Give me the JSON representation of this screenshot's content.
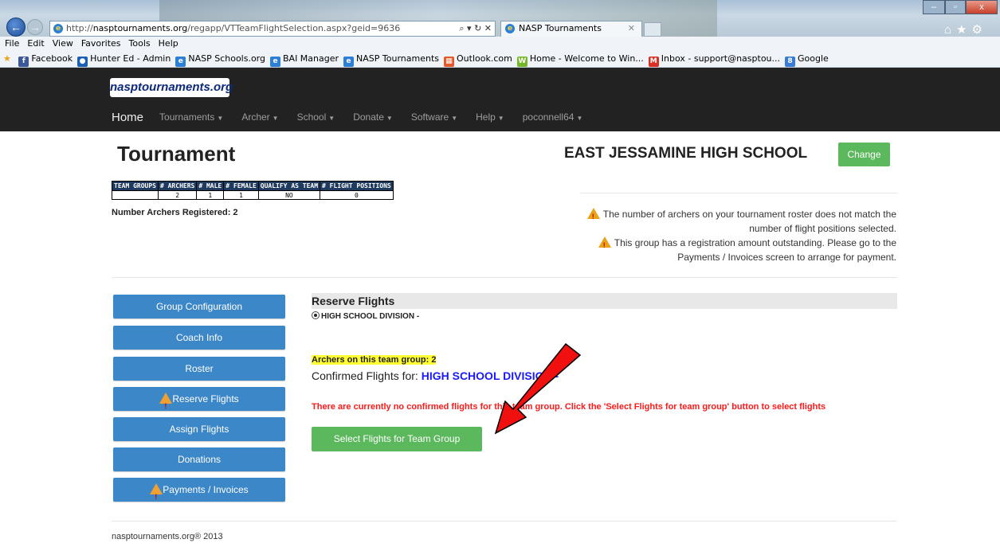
{
  "browser": {
    "url_prefix": "http://",
    "url_host": "nasptournaments.org",
    "url_path": "/regapp/VTTeamFlightSelection.aspx?geid=9636",
    "url_tools": "⌕ ▾ ↻ ✕",
    "tab_title": "NASP Tournaments",
    "tab_close": "✕",
    "menu": [
      "File",
      "Edit",
      "View",
      "Favorites",
      "Tools",
      "Help"
    ],
    "window_controls": {
      "minimize": "–",
      "maximize": "▫",
      "close": "x"
    },
    "top_right_icons": "⌂★⚙",
    "favorites": [
      {
        "label": "Facebook",
        "icon": "f",
        "color": "#3b5998"
      },
      {
        "label": "Hunter Ed - Admin",
        "icon": "●",
        "color": "#1a5fb4"
      },
      {
        "label": "NASP Schools.org",
        "icon": "e",
        "color": "#2b7fd4"
      },
      {
        "label": "BAI Manager",
        "icon": "e",
        "color": "#2b7fd4"
      },
      {
        "label": "NASP Tournaments",
        "icon": "e",
        "color": "#2b7fd4"
      },
      {
        "label": "Outlook.com",
        "icon": "▦",
        "color": "#e05a2a"
      },
      {
        "label": "Home - Welcome to Win...",
        "icon": "W",
        "color": "#76b729"
      },
      {
        "label": "Inbox - support@nasptou...",
        "icon": "M",
        "color": "#d93025"
      },
      {
        "label": "Google",
        "icon": "8",
        "color": "#3a7bd5"
      }
    ]
  },
  "site": {
    "logo": "nasptournaments.org",
    "nav": [
      {
        "label": "Home",
        "caret": false
      },
      {
        "label": "Tournaments",
        "caret": true
      },
      {
        "label": "Archer",
        "caret": true
      },
      {
        "label": "School",
        "caret": true
      },
      {
        "label": "Donate",
        "caret": true
      },
      {
        "label": "Software",
        "caret": true
      },
      {
        "label": "Help",
        "caret": true
      },
      {
        "label": "poconnell64",
        "caret": true
      }
    ]
  },
  "page": {
    "title": "Tournament",
    "school_name": "EAST JESSAMINE HIGH SCHOOL",
    "change_label": "Change",
    "stats_headers": [
      "TEAM GROUPS",
      "# ARCHERS",
      "# MALE",
      "# FEMALE",
      "QUALIFY AS TEAM",
      "# FLIGHT POSITIONS"
    ],
    "stats_values": [
      "",
      "2",
      "1",
      "1",
      "NO",
      "0"
    ],
    "registered": "Number Archers Registered: 2",
    "warning1_line1": "The number of archers on your tournament roster does not match the",
    "warning1_line2": "number of flight positions selected.",
    "warning2_line1": "This group has a registration amount outstanding. Please go to the",
    "warning2_line2": "Payments / Invoices screen to arrange for payment."
  },
  "sidebar": [
    {
      "label": "Group Configuration",
      "warn": false
    },
    {
      "label": "Coach Info",
      "warn": false
    },
    {
      "label": "Roster",
      "warn": false
    },
    {
      "label": "Reserve Flights",
      "warn": true
    },
    {
      "label": "Assign Flights",
      "warn": false
    },
    {
      "label": "Donations",
      "warn": false
    },
    {
      "label": "Payments / Invoices",
      "warn": true
    }
  ],
  "main": {
    "section_title": "Reserve Flights",
    "division": "HIGH SCHOOL DIVISION -",
    "archers_on_group": "Archers on this team group: 2",
    "confirmed_prefix": "Confirmed Flights for:",
    "confirmed_division": "HIGH SCHOOL DIVISION -",
    "no_flights_msg": "There are currently no confirmed flights for this team group. Click the 'Select Flights for team group' button to select flights",
    "select_button": "Select Flights for Team Group"
  },
  "footer": "nasptournaments.org® 2013"
}
